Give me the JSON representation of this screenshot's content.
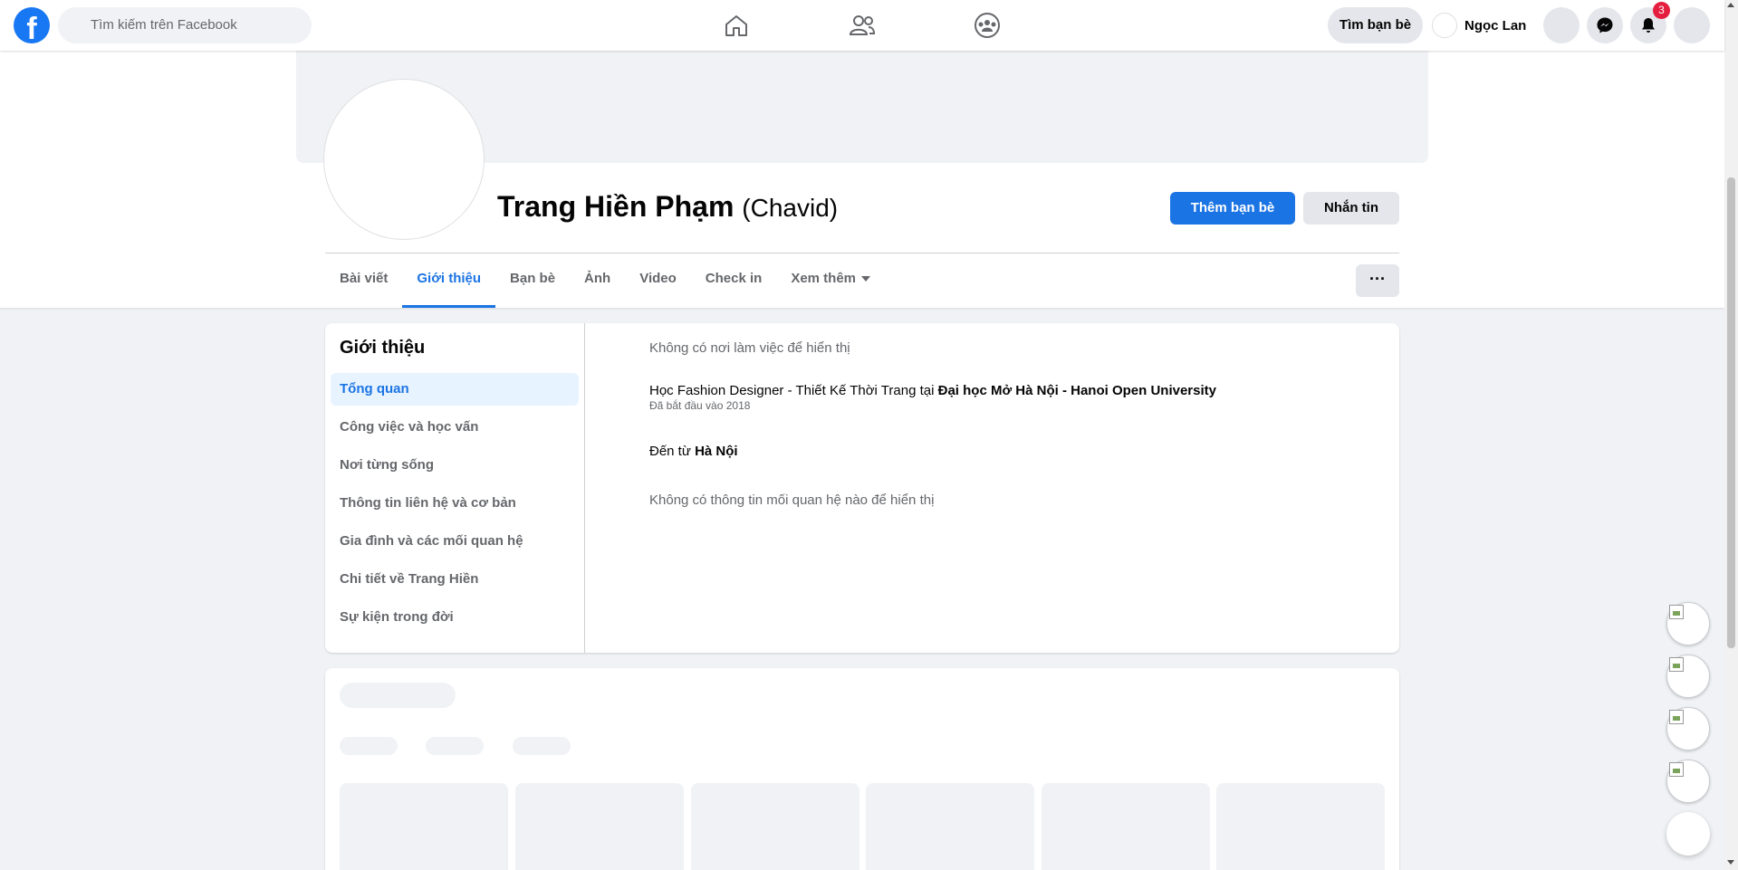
{
  "topbar": {
    "logo": "f",
    "search_placeholder": "Tìm kiếm trên Facebook",
    "nav_icons": [
      "home-icon",
      "friends-icon",
      "groups-icon"
    ],
    "find_friends_label": "Tìm bạn bè",
    "user_name": "Ngọc Lan",
    "notification_count": "3"
  },
  "profile": {
    "name": "Trang Hiền Phạm",
    "alt_name": "(Chavid)",
    "add_friend_label": "Thêm bạn bè",
    "message_label": "Nhắn tin",
    "tabs": [
      {
        "label": "Bài viết"
      },
      {
        "label": "Giới thiệu"
      },
      {
        "label": "Bạn bè"
      },
      {
        "label": "Ảnh"
      },
      {
        "label": "Video"
      },
      {
        "label": "Check in"
      },
      {
        "label": "Xem thêm"
      }
    ],
    "more_button": "···"
  },
  "about": {
    "title": "Giới thiệu",
    "menu": [
      {
        "label": "Tổng quan"
      },
      {
        "label": "Công việc và học vấn"
      },
      {
        "label": "Nơi từng sống"
      },
      {
        "label": "Thông tin liên hệ và cơ bản"
      },
      {
        "label": "Gia đình và các mối quan hệ"
      },
      {
        "label": "Chi tiết về Trang Hiền"
      },
      {
        "label": "Sự kiện trong đời"
      }
    ],
    "no_work": "Không có nơi làm việc để hiển thị",
    "study_prefix": "Học Fashion Designer - Thiết Kế Thời Trang tại ",
    "study_school": "Đại học Mở Hà Nội - Hanoi Open University",
    "study_since": "Đã bắt đầu vào 2018",
    "from_prefix": "Đến từ ",
    "from_place": "Hà Nội",
    "no_relationship": "Không có thông tin mối quan hệ nào để hiển thị"
  },
  "colors": {
    "accent": "#1b74e4",
    "badge": "#e41e3f",
    "background": "#f0f2f5"
  }
}
